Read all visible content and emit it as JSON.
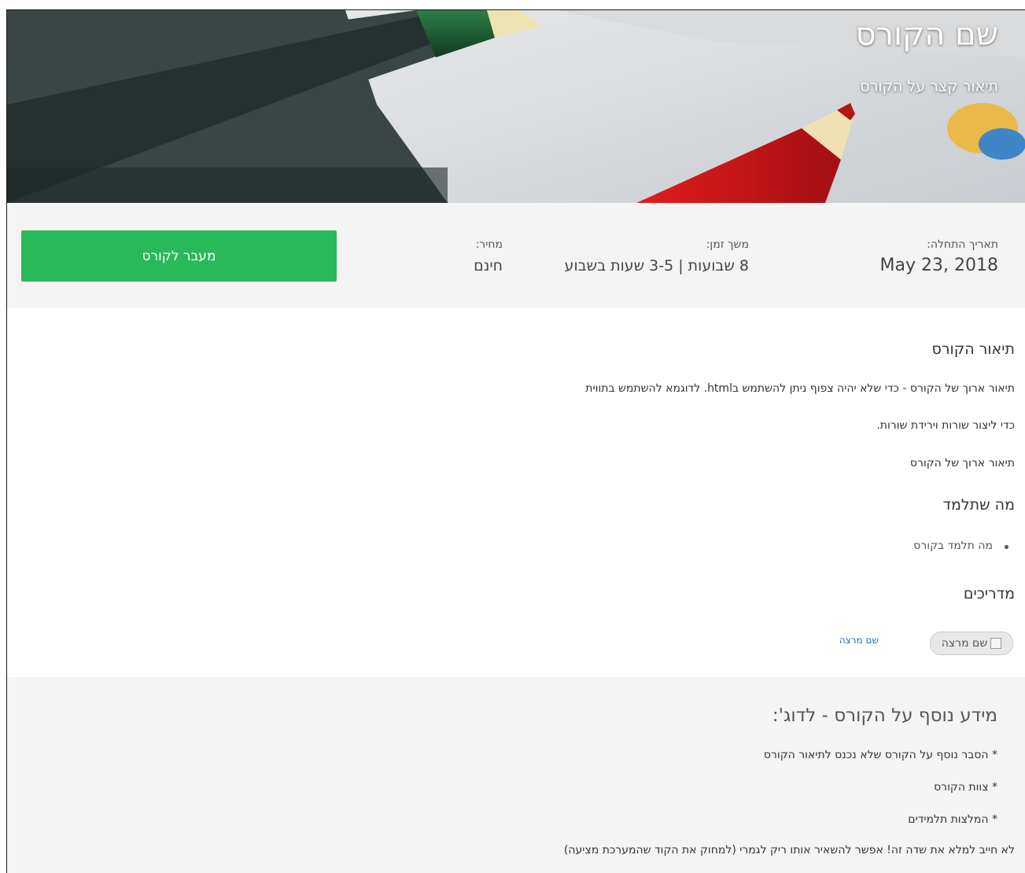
{
  "hero": {
    "title": "שם הקורס",
    "subtitle": "תיאור קצר על הקורס"
  },
  "info": {
    "start_label": "תאריך התחלה:",
    "start_value": "May 23, 2018",
    "duration_label": "משך זמן:",
    "duration_value": "8 שבועות | 3-5 שעות בשבוע",
    "price_label": "מחיר:",
    "price_value": "חינם",
    "cta_label": "מעבר לקורס"
  },
  "description": {
    "heading": "תיאור הקורס",
    "lines": [
      "תיאור ארוך של הקורס - כדי שלא יהיה צפוף ניתן להשתמש בhtml. לדוגמא להשתמש בתווית",
      "כדי ליצור שורות וירידת שורות.",
      "תיאור ארוך של הקורס"
    ]
  },
  "learn": {
    "heading": "מה שתלמד",
    "items": [
      "מה תלמד בקורס"
    ]
  },
  "instructors": {
    "heading": "מדריכים",
    "image_alt": "שם מרצה",
    "name_link": "שם מרצה"
  },
  "more_info": {
    "heading": "מידע נוסף על הקורס - לדוג':",
    "lines": [
      "* הסבר נוסף על הקורס שלא נכנס לתיאור הקורס",
      "* צוות הקורס",
      "* המלצות תלמידים"
    ],
    "note": "לא חייב למלא את שדה זה! אפשר להשאיר אותו ריק לגמרי (למחוק את הקוד שהמערכת מציעה)"
  },
  "colors": {
    "cta": "#29b959",
    "link": "#2a6fb5",
    "band": "#f4f4f4"
  }
}
